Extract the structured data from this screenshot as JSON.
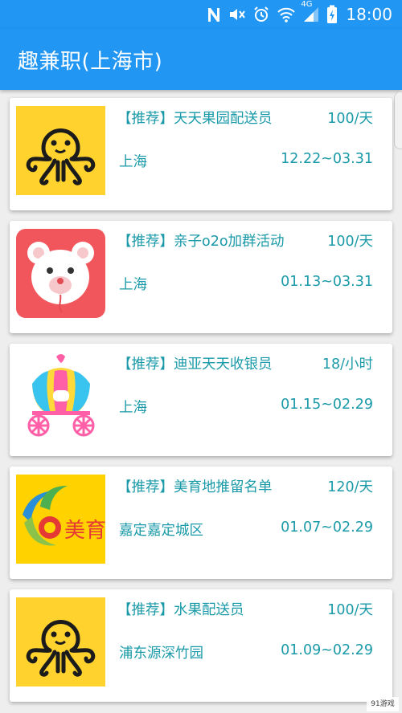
{
  "status_bar": {
    "network_type": "4G",
    "time": "18:00",
    "icons": [
      "n-icon",
      "vibrate-mute-icon",
      "alarm-icon",
      "wifi-icon",
      "signal-icon",
      "battery-charging-icon"
    ]
  },
  "app_bar": {
    "title": "趣兼职(上海市)",
    "color": "#2196f3"
  },
  "jobs": [
    {
      "title": "【推荐】天天果园配送员",
      "salary": "100/天",
      "location": "上海",
      "dates": "12.22~03.31",
      "thumbnail": "octopus-logo"
    },
    {
      "title": "【推荐】亲子o2o加群活动",
      "salary": "100/天",
      "location": "上海",
      "dates": "01.13~03.31",
      "thumbnail": "teddy-bear-logo"
    },
    {
      "title": "【推荐】迪亚天天收银员",
      "salary": "18/小时",
      "location": "上海",
      "dates": "01.15~02.29",
      "thumbnail": "carriage-logo"
    },
    {
      "title": "【推荐】美育地推留名单",
      "salary": "120/天",
      "location": "嘉定嘉定城区",
      "dates": "01.07~02.29",
      "thumbnail": "meiyu-logo",
      "thumbnail_text": "美育"
    },
    {
      "title": "【推荐】水果配送员",
      "salary": "100/天",
      "location": "浦东源深竹园",
      "dates": "01.09~02.29",
      "thumbnail": "octopus-logo"
    }
  ],
  "text_color": "#1a9aa8",
  "watermark": "91游戏"
}
